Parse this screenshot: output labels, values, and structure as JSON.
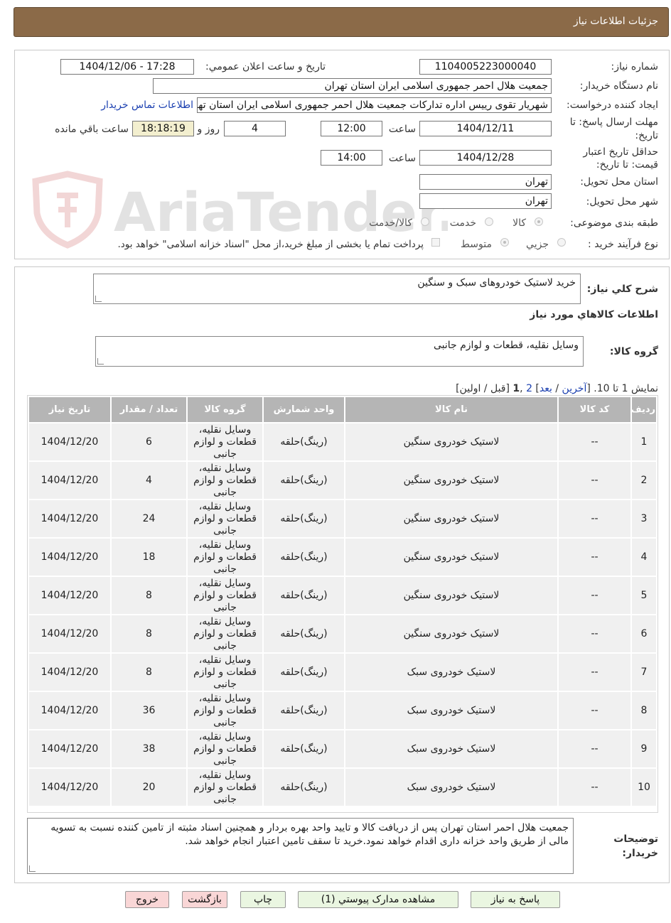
{
  "window": {
    "title": "جزئیات اطلاعات نیاز"
  },
  "watermark": {
    "text": "AriaTender.neT"
  },
  "info": {
    "need_number_label": "شماره نیاز:",
    "need_number": "1104005223000040",
    "announce_label": "تاریخ و ساعت اعلان عمومي:",
    "announce_value": "1404/12/06 - 17:28",
    "buyer_label": "نام دستگاه خریدار:",
    "buyer_value": "جمعیت هلال احمر جمهوری اسلامی ایران استان تهران",
    "creator_label": "ایجاد کننده درخواست:",
    "creator_value": "شهریار تقوی رییس اداره تدارکات جمعیت هلال احمر جمهوری اسلامی ایران استان تهران",
    "contact_link": "اطلاعات تماس خریدار",
    "deadline_label_1": "مهلت ارسال پاسخ: تا",
    "deadline_label_2": "تاریخ:",
    "deadline_date": "1404/12/11",
    "time_label": "ساعت",
    "deadline_time": "12:00",
    "days_value": "4",
    "days_label": "روز و",
    "remaining_value": "18:18:19",
    "remaining_label": "ساعت باقي مانده",
    "validity_label_1": "حداقل تاریخ اعتبار",
    "validity_label_2": "قیمت: تا تاریخ:",
    "validity_date": "1404/12/28",
    "validity_time": "14:00",
    "province_label": "استان محل تحویل:",
    "province_value": "تهران",
    "city_label": "شهر محل تحویل:",
    "city_value": "تهران",
    "category_label": "طبقه بندی موضوعی:",
    "category_options": [
      "کالا",
      "خدمت",
      "کالا/خدمت"
    ],
    "process_label": "نوع فرآیند خرید :",
    "process_options": [
      "جزیي",
      "متوسط"
    ],
    "payment_note": "پرداخت تمام یا بخشی از مبلغ خرید،از محل \"اسناد خزانه اسلامی\" خواهد بود."
  },
  "summary": {
    "label": "شرح کلي نیاز:",
    "value": "خرید لاستیک خودروهای سبک و سنگین",
    "goods_info_title": "اطلاعات کالاهاي مورد نیاز",
    "group_label": "گروه کالا:",
    "group_value": "وسایل نقلیه، قطعات و لوازم جانبی"
  },
  "pagination": {
    "prefix": "نمایش 1 تا 10. [",
    "last": "آخرین",
    "sep1": " / ",
    "next": "بعد",
    "mid": "] ",
    "page2": "2",
    "comma": " ,",
    "page1": "1",
    "suffix": " [قبل / اولین]"
  },
  "table": {
    "headers": [
      "ردیف",
      "کد کالا",
      "نام کالا",
      "واحد شمارش",
      "گروه کالا",
      "تعداد / مقدار",
      "تاریخ نیاز"
    ],
    "rows": [
      [
        "1",
        "--",
        "لاستیک خودروی سنگین",
        "(رینگ)حلقه",
        "وسایل نقلیه، قطعات و لوازم جانبی",
        "6",
        "1404/12/20"
      ],
      [
        "2",
        "--",
        "لاستیک خودروی سنگین",
        "(رینگ)حلقه",
        "وسایل نقلیه، قطعات و لوازم جانبی",
        "4",
        "1404/12/20"
      ],
      [
        "3",
        "--",
        "لاستیک خودروی سنگین",
        "(رینگ)حلقه",
        "وسایل نقلیه، قطعات و لوازم جانبی",
        "24",
        "1404/12/20"
      ],
      [
        "4",
        "--",
        "لاستیک خودروی سنگین",
        "(رینگ)حلقه",
        "وسایل نقلیه، قطعات و لوازم جانبی",
        "18",
        "1404/12/20"
      ],
      [
        "5",
        "--",
        "لاستیک خودروی سنگین",
        "(رینگ)حلقه",
        "وسایل نقلیه، قطعات و لوازم جانبی",
        "8",
        "1404/12/20"
      ],
      [
        "6",
        "--",
        "لاستیک خودروی سنگین",
        "(رینگ)حلقه",
        "وسایل نقلیه، قطعات و لوازم جانبی",
        "8",
        "1404/12/20"
      ],
      [
        "7",
        "--",
        "لاستیک خودروی سبک",
        "(رینگ)حلقه",
        "وسایل نقلیه، قطعات و لوازم جانبی",
        "8",
        "1404/12/20"
      ],
      [
        "8",
        "--",
        "لاستیک خودروی سبک",
        "(رینگ)حلقه",
        "وسایل نقلیه، قطعات و لوازم جانبی",
        "36",
        "1404/12/20"
      ],
      [
        "9",
        "--",
        "لاستیک خودروی سبک",
        "(رینگ)حلقه",
        "وسایل نقلیه، قطعات و لوازم جانبی",
        "38",
        "1404/12/20"
      ],
      [
        "10",
        "--",
        "لاستیک خودروی سبک",
        "(رینگ)حلقه",
        "وسایل نقلیه، قطعات و لوازم جانبی",
        "20",
        "1404/12/20"
      ]
    ]
  },
  "notes": {
    "label_1": "توضیحات",
    "label_2": "خریدار:",
    "value": "جمعیت هلال احمر استان تهران پس از دریافت کالا و تایید واحد بهره بردار و همچنین اسناد مثبته از تامین کننده نسبت به تسویه مالی از طریق واحد خزانه داری اقدام خواهد نمود.خرید تا سقف تامین اعتبار انجام خواهد شد."
  },
  "buttons": {
    "reply": "پاسخ به نیاز",
    "attachments": "مشاهده مدارک پیوستي (1)",
    "print": "چاپ",
    "back": "بازگشت",
    "exit": "خروج"
  },
  "colors": {
    "header_bg": "#8b6a48",
    "table_header_bg": "#b5b5b5",
    "row_bg": "#f0f0f0",
    "remaining_bg": "#f3efcf",
    "link": "#1a3fb0"
  }
}
